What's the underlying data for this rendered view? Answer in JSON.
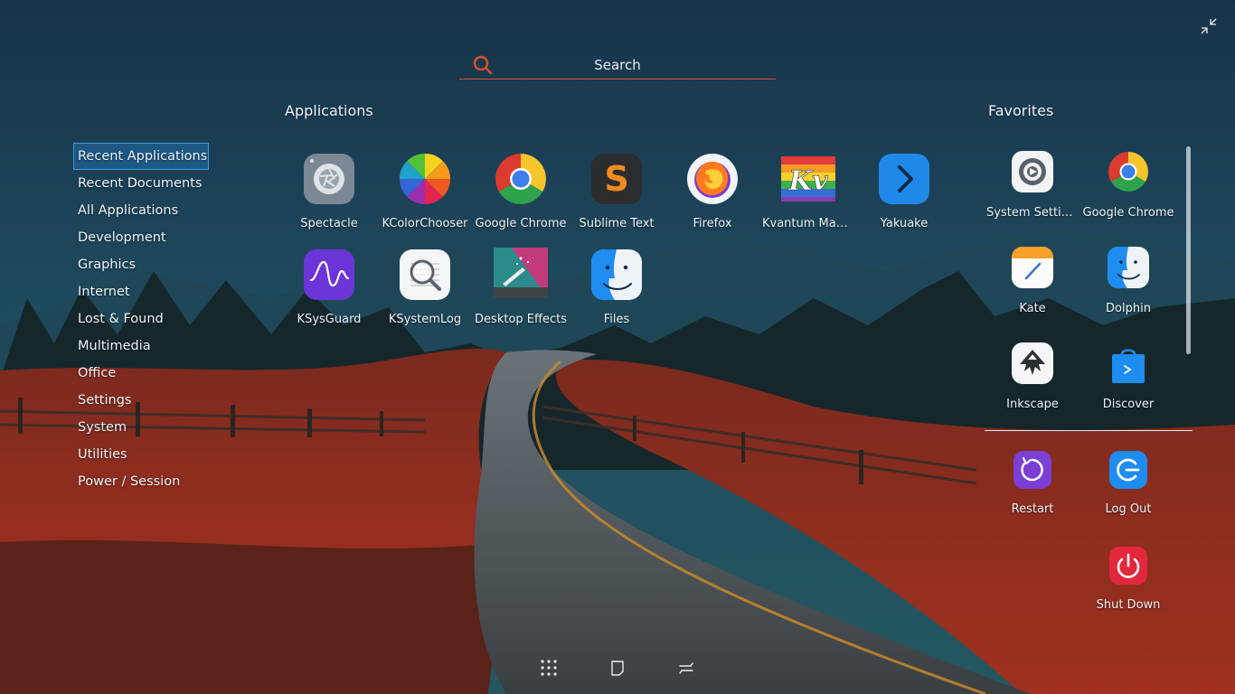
{
  "search": {
    "placeholder": "Search"
  },
  "sections": {
    "applications": "Applications",
    "favorites": "Favorites"
  },
  "categories": [
    "Recent Applications",
    "Recent Documents",
    "All Applications",
    "Development",
    "Graphics",
    "Internet",
    "Lost & Found",
    "Multimedia",
    "Office",
    "Settings",
    "System",
    "Utilities",
    "Power / Session"
  ],
  "active_category": "Recent Applications",
  "apps": [
    {
      "label": "Spectacle",
      "icon": "spectacle-icon"
    },
    {
      "label": "KColorChooser",
      "icon": "kcolorchooser-icon"
    },
    {
      "label": "Google Chrome",
      "icon": "chrome-icon"
    },
    {
      "label": "Sublime Text",
      "icon": "sublime-text-icon"
    },
    {
      "label": "Firefox",
      "icon": "firefox-icon"
    },
    {
      "label": "Kvantum Man...",
      "icon": "kvantum-icon"
    },
    {
      "label": "Yakuake",
      "icon": "yakuake-icon"
    },
    {
      "label": "KSysGuard",
      "icon": "ksysguard-icon"
    },
    {
      "label": "KSystemLog",
      "icon": "ksystemlog-icon"
    },
    {
      "label": "Desktop Effects",
      "icon": "desktop-effects-icon"
    },
    {
      "label": "Files",
      "icon": "files-icon"
    }
  ],
  "kvantum_logo": "Kv",
  "sublime_logo": "S",
  "favorites": [
    {
      "label": "System Settings",
      "icon": "system-settings-icon"
    },
    {
      "label": "Google Chrome",
      "icon": "chrome-icon"
    },
    {
      "label": "Kate",
      "icon": "kate-icon"
    },
    {
      "label": "Dolphin",
      "icon": "dolphin-icon"
    },
    {
      "label": "Inkscape",
      "icon": "inkscape-icon"
    },
    {
      "label": "Discover",
      "icon": "discover-icon"
    }
  ],
  "power": [
    {
      "label": "Restart",
      "icon": "restart-icon"
    },
    {
      "label": "Log Out",
      "icon": "logout-icon"
    },
    {
      "label": "Shut Down",
      "icon": "shutdown-icon"
    }
  ],
  "colors": {
    "accent": "#d9532a",
    "selection": "#3d9ae0",
    "text": "#eef3f7"
  }
}
